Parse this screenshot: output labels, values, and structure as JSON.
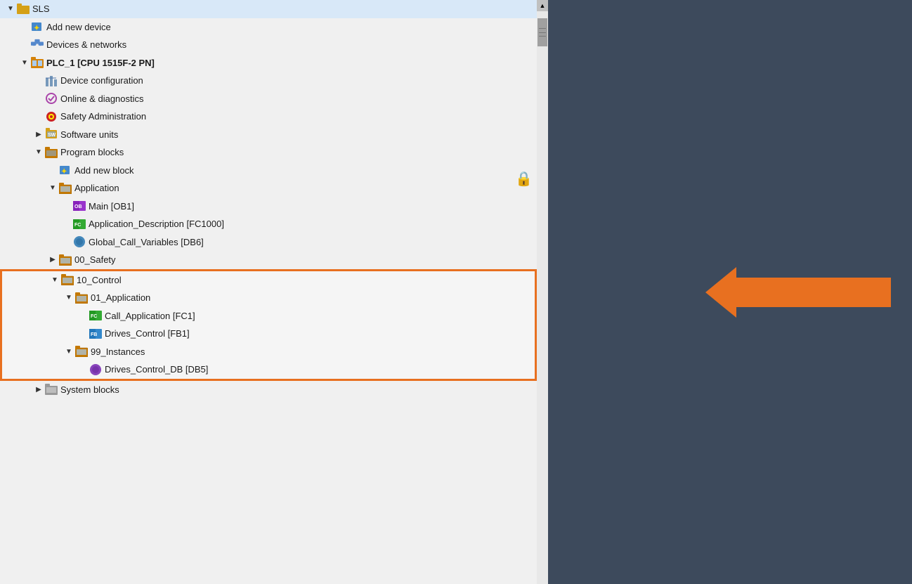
{
  "tree": {
    "root": {
      "label": "SLS",
      "icon": "folder-icon"
    },
    "items": [
      {
        "id": "add-device",
        "label": "Add new device",
        "icon": "star",
        "indent": 2
      },
      {
        "id": "devices-networks",
        "label": "Devices & networks",
        "icon": "network",
        "indent": 2
      },
      {
        "id": "plc1",
        "label": "PLC_1 [CPU 1515F-2 PN]",
        "icon": "cpu-folder",
        "indent": 2,
        "expanded": true
      },
      {
        "id": "device-config",
        "label": "Device configuration",
        "icon": "config",
        "indent": 3
      },
      {
        "id": "online-diag",
        "label": "Online & diagnostics",
        "icon": "diagnostic",
        "indent": 3
      },
      {
        "id": "safety-admin",
        "label": "Safety Administration",
        "icon": "safety",
        "indent": 3
      },
      {
        "id": "software-units",
        "label": "Software units",
        "icon": "sw-block",
        "indent": 3,
        "expanded": false
      },
      {
        "id": "program-blocks",
        "label": "Program blocks",
        "icon": "prog-folder",
        "indent": 3,
        "expanded": true
      },
      {
        "id": "add-block",
        "label": "Add new block",
        "icon": "star",
        "indent": 4
      },
      {
        "id": "application",
        "label": "Application",
        "icon": "app-folder",
        "indent": 4,
        "expanded": true
      },
      {
        "id": "main-ob1",
        "label": "Main [OB1]",
        "icon": "ob-purple",
        "indent": 5
      },
      {
        "id": "app-desc",
        "label": "Application_Description [FC1000]",
        "icon": "fc-green",
        "indent": 5
      },
      {
        "id": "global-call",
        "label": "Global_Call_Variables [DB6]",
        "icon": "db-blue",
        "indent": 5
      },
      {
        "id": "safety-00",
        "label": "00_Safety",
        "icon": "app-folder",
        "indent": 4,
        "expanded": false
      },
      {
        "id": "control-10",
        "label": "10_Control",
        "icon": "app-folder",
        "indent": 4,
        "expanded": true,
        "highlighted": true
      },
      {
        "id": "app-01",
        "label": "01_Application",
        "icon": "app-folder",
        "indent": 5,
        "expanded": true,
        "highlighted": true
      },
      {
        "id": "call-app-fc1",
        "label": "Call_Application [FC1]",
        "icon": "fc-green",
        "indent": 6,
        "highlighted": true
      },
      {
        "id": "drives-ctrl-fb1",
        "label": "Drives_Control [FB1]",
        "icon": "fb-blue",
        "indent": 6,
        "highlighted": true
      },
      {
        "id": "instances-99",
        "label": "99_Instances",
        "icon": "app-folder",
        "indent": 5,
        "expanded": true,
        "highlighted": true
      },
      {
        "id": "drives-ctrl-db5",
        "label": "Drives_Control_DB [DB5]",
        "icon": "db-purple",
        "indent": 6,
        "highlighted": true
      },
      {
        "id": "system-blocks",
        "label": "System blocks",
        "icon": "system",
        "indent": 3,
        "expanded": false
      }
    ]
  },
  "arrow": {
    "color": "#e87020",
    "direction": "left"
  },
  "lock": {
    "symbol": "🔒"
  }
}
